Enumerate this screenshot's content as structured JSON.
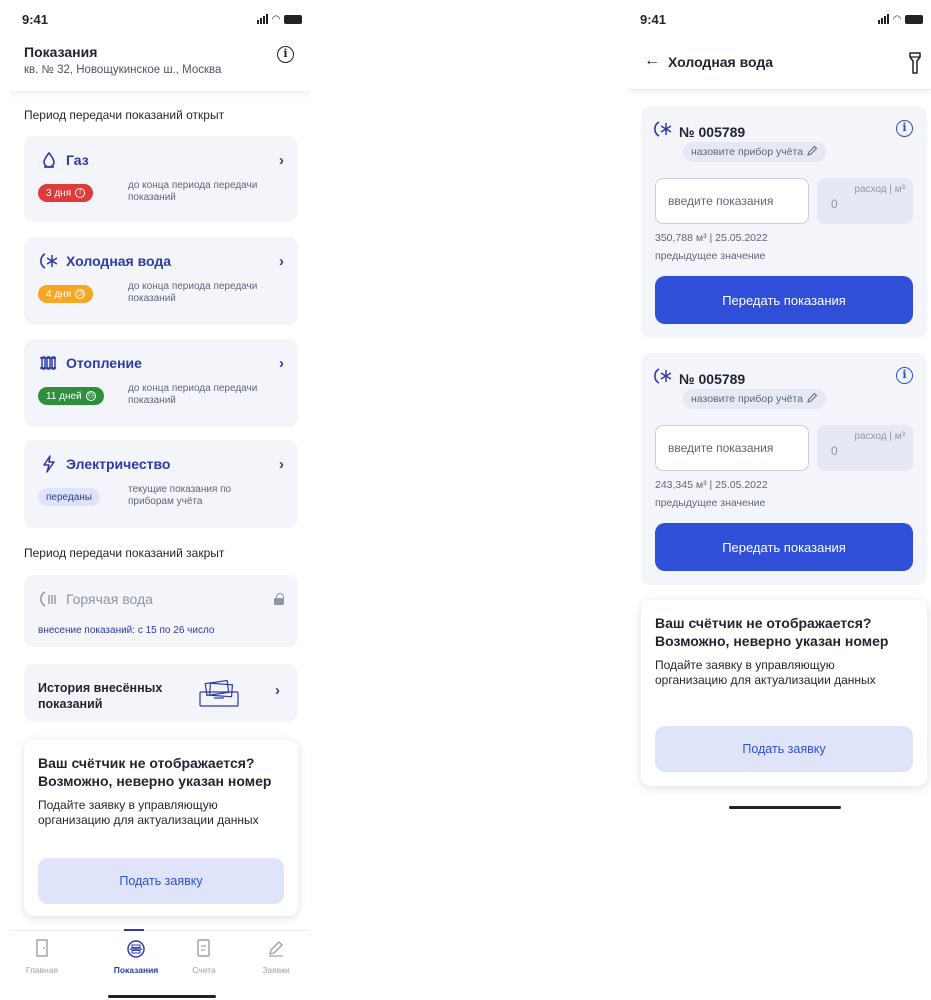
{
  "status": {
    "time": "9:41"
  },
  "left": {
    "header": {
      "title": "Показания",
      "address": "кв. № 32, Новощукинское ш., Москва"
    },
    "open_section_title": "Период передачи показаний открыт",
    "closed_section_title": "Период передачи показаний закрыт",
    "services": [
      {
        "name": "Газ",
        "badge": "3 дня",
        "note": "до конца периода передачи показаний",
        "color": "#e03b3b"
      },
      {
        "name": "Холодная вода",
        "badge": "4 дня",
        "note": "до конца периода передачи показаний",
        "color": "#f5a623"
      },
      {
        "name": "Отопление",
        "badge": "11 дней",
        "note": "до конца периода передачи показаний",
        "color": "#2d8f3c"
      },
      {
        "name": "Электричество",
        "badge": "переданы",
        "note": "текущие показания по приборам учёта",
        "color": "#dfe4fa"
      }
    ],
    "closed_service": {
      "name": "Горячая вода",
      "note": "внесение показаний: с 15 по 26 число"
    },
    "history": {
      "label": "История внесённых показаний"
    },
    "problem": {
      "title": "Ваш счётчик не отображается? Возможно, неверно указан номер",
      "text": "Подайте заявку в управляющую организацию для актуализации данных",
      "button": "Подать заявку"
    },
    "tabs": [
      {
        "label": "Главная",
        "active": false
      },
      {
        "label": "Показания",
        "active": true
      },
      {
        "label": "Счета",
        "active": false
      },
      {
        "label": "Заявки",
        "active": false
      }
    ]
  },
  "right": {
    "header": {
      "back": "←",
      "title": "Холодная вода"
    },
    "meters": [
      {
        "number": "№ 005789",
        "name_chip": "назовите прибор учёта",
        "input_placeholder": "введите показания",
        "consumption_label": "расход | м³",
        "consumption_value": "0",
        "prev_value": "350,788 м³ | 25.05.2022",
        "prev_label": "предыдущее значение",
        "button": "Передать показания"
      },
      {
        "number": "№ 005789",
        "name_chip": "назовите прибор учёта",
        "input_placeholder": "введите показания",
        "consumption_label": "расход | м³",
        "consumption_value": "0",
        "prev_value": "243,345 м³ | 25.05.2022",
        "prev_label": "предыдущее значение",
        "button": "Передать показания"
      }
    ],
    "problem": {
      "title": "Ваш счётчик не отображается? Возможно, неверно указан номер",
      "text": "Подайте заявку в управляющую организацию для актуализации данных",
      "button": "Подать заявку"
    }
  },
  "colors": {
    "accent": "#2f4fd9",
    "brand_dark": "#2e3aa6",
    "card_bg": "#f3f5fb"
  },
  "icons": [
    "gas-icon",
    "snowflake-icon",
    "radiator-icon",
    "lightning-icon",
    "hot-water-icon",
    "lock-icon",
    "info-icon",
    "flashlight-icon",
    "pencil-icon",
    "clock-icon"
  ]
}
